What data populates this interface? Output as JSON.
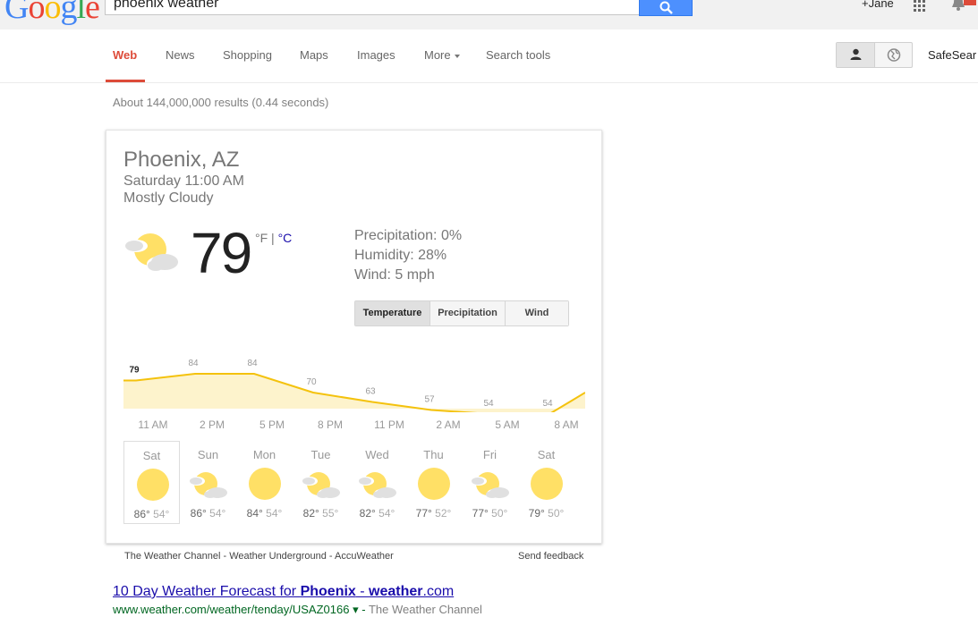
{
  "header": {
    "logo": "Google",
    "search_query": "phoenix weather",
    "user_name": "+Jane",
    "search_icon": "search-icon",
    "apps_icon": "apps-grid-icon",
    "bell_icon": "notifications-bell-icon"
  },
  "nav": {
    "tabs": [
      "Web",
      "News",
      "Shopping",
      "Maps",
      "Images",
      "More",
      "Search tools"
    ],
    "active_tab": "Web",
    "person_icon": "person-icon",
    "globe_icon": "globe-icon",
    "safesearch": "SafeSear"
  },
  "result_stats": "About 144,000,000 results (0.44 seconds)",
  "weather": {
    "location": "Phoenix, AZ",
    "datetime": "Saturday 11:00 AM",
    "condition": "Mostly Cloudy",
    "temperature": "79",
    "unit_f": "°F",
    "unit_sep": "|",
    "unit_c": "°C",
    "precipitation": "Precipitation: 0%",
    "humidity": "Humidity: 28%",
    "wind": "Wind: 5 mph",
    "buttons": [
      "Temperature",
      "Precipitation",
      "Wind"
    ],
    "active_button": "Temperature",
    "colors": {
      "chart_line": "#f4c20d",
      "chart_fill": "#fdf3cc",
      "sun": "#ffe066",
      "cloud": "#e0e0e0"
    },
    "chart_data": {
      "type": "area",
      "x": [
        "11 AM",
        "2 PM",
        "5 PM",
        "8 PM",
        "11 PM",
        "2 AM",
        "5 AM",
        "8 AM"
      ],
      "values": [
        79,
        84,
        84,
        70,
        63,
        57,
        54,
        54
      ],
      "labels": [
        "79",
        "84",
        "84",
        "70",
        "63",
        "57",
        "54",
        "54"
      ]
    },
    "days": [
      {
        "name": "Sat",
        "hi": "86°",
        "lo": "54°",
        "icon": "sunny-icon"
      },
      {
        "name": "Sun",
        "hi": "86°",
        "lo": "54°",
        "icon": "partly-cloudy-icon"
      },
      {
        "name": "Mon",
        "hi": "84°",
        "lo": "54°",
        "icon": "sunny-icon"
      },
      {
        "name": "Tue",
        "hi": "82°",
        "lo": "55°",
        "icon": "partly-cloudy-icon"
      },
      {
        "name": "Wed",
        "hi": "82°",
        "lo": "54°",
        "icon": "partly-cloudy-icon"
      },
      {
        "name": "Thu",
        "hi": "77°",
        "lo": "52°",
        "icon": "sunny-icon"
      },
      {
        "name": "Fri",
        "hi": "77°",
        "lo": "50°",
        "icon": "partly-cloudy-icon"
      },
      {
        "name": "Sat",
        "hi": "79°",
        "lo": "50°",
        "icon": "sunny-icon"
      }
    ],
    "sources": "The Weather Channel - Weather Underground - AccuWeather",
    "feedback": "Send feedback"
  },
  "result": {
    "title_prefix": "10 Day Weather Forecast for ",
    "title_bold": "Phoenix",
    "title_sep": " - ",
    "title_bold2": "weather",
    "title_suffix": ".com",
    "url": "www.weather.com/weather/tenday/USAZ0166",
    "url_arrow": "▾",
    "source": "The Weather Channel"
  }
}
